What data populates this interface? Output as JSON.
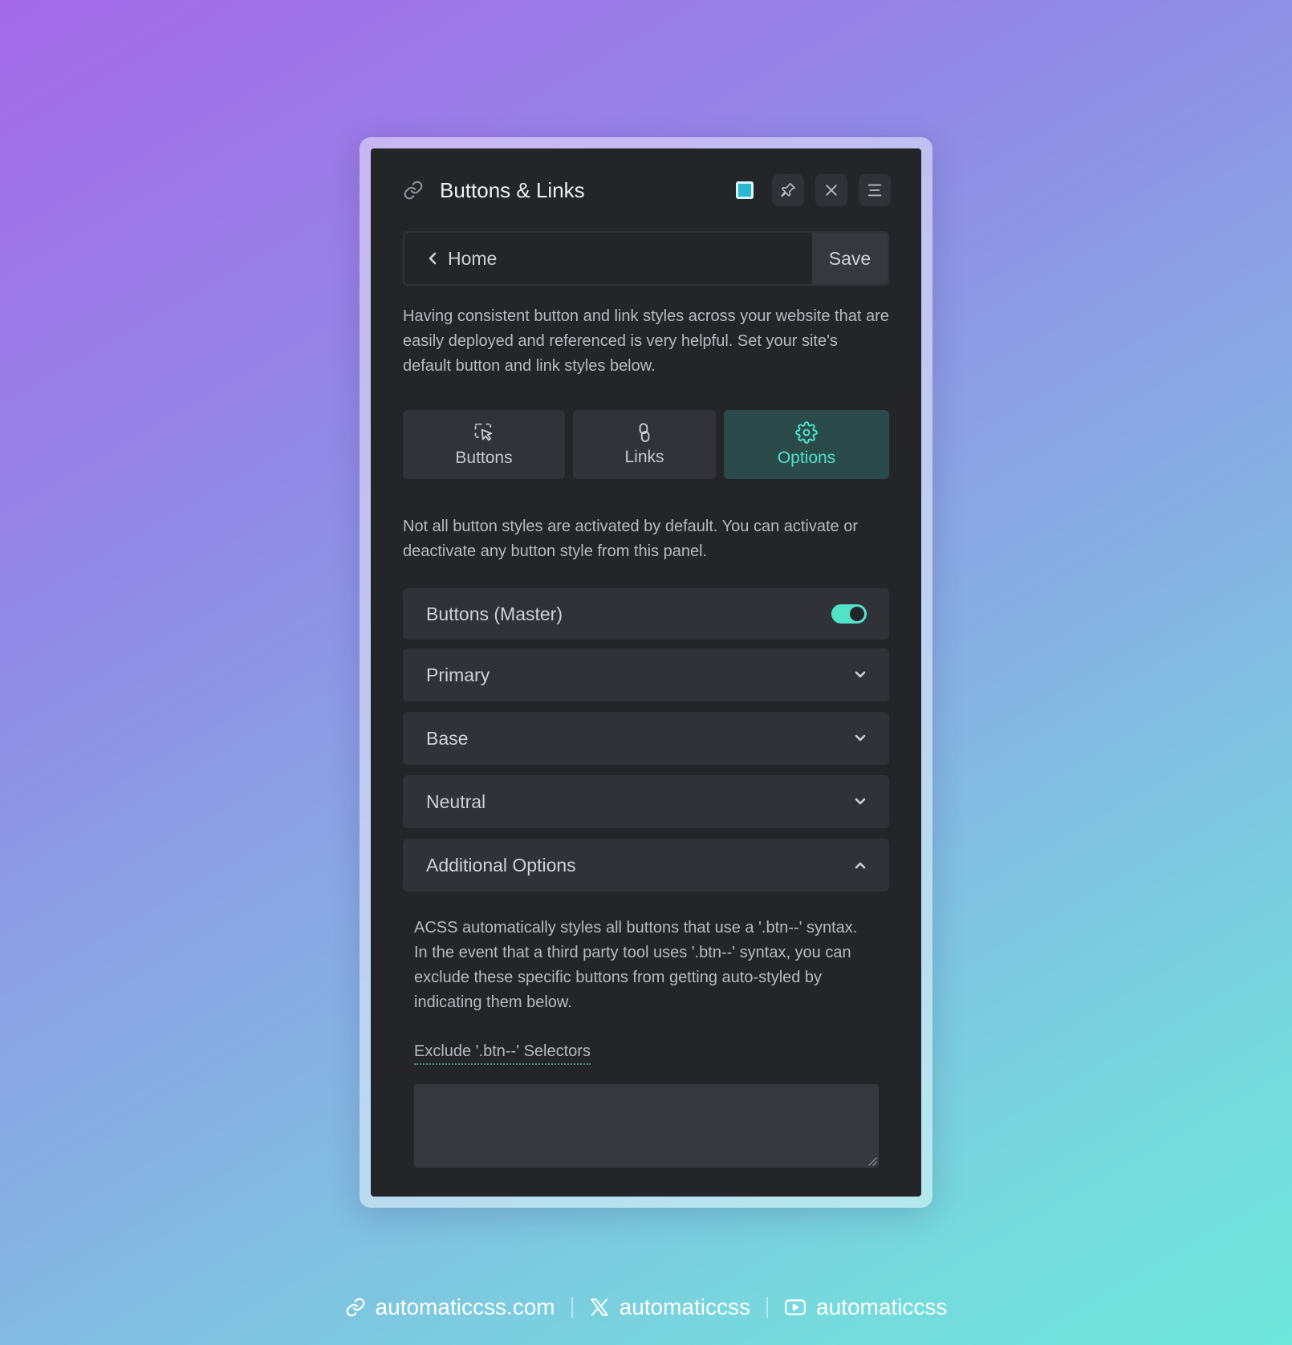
{
  "header": {
    "title": "Buttons & Links",
    "icons": [
      "link-icon",
      "color-square-icon",
      "pin-icon",
      "close-icon",
      "menu-icon"
    ]
  },
  "nav": {
    "back_label": "Home",
    "save_label": "Save"
  },
  "intro": "Having consistent button and link styles across your website that are easily deployed and referenced is very helpful. Set your site's default button and link styles below.",
  "tabs": [
    {
      "label": "Buttons",
      "icon": "pointer-click-icon"
    },
    {
      "label": "Links",
      "icon": "chain-link-icon"
    },
    {
      "label": "Options",
      "icon": "gear-icon",
      "active": true
    }
  ],
  "options_note": "Not all button styles are activated by default. You can activate or deactivate any button style from this panel.",
  "master": {
    "label": "Buttons (Master)",
    "enabled": true
  },
  "accordions": [
    {
      "label": "Primary",
      "expanded": false
    },
    {
      "label": "Base",
      "expanded": false
    },
    {
      "label": "Neutral",
      "expanded": false
    },
    {
      "label": "Additional Options",
      "expanded": true
    }
  ],
  "additional": {
    "description": "ACSS automatically styles all buttons that use a '.btn--' syntax. In the event that a third party tool uses '.btn--' syntax, you can exclude these specific buttons from getting auto-styled by indicating them below.",
    "field_label": "Exclude '.btn--' Selectors",
    "field_value": ""
  },
  "footer": {
    "website": "automaticcss.com",
    "x_handle": "automaticcss",
    "youtube_handle": "automaticcss"
  },
  "colors": {
    "accent": "#50e3c8",
    "panel": "#242529",
    "control": "#313237"
  }
}
